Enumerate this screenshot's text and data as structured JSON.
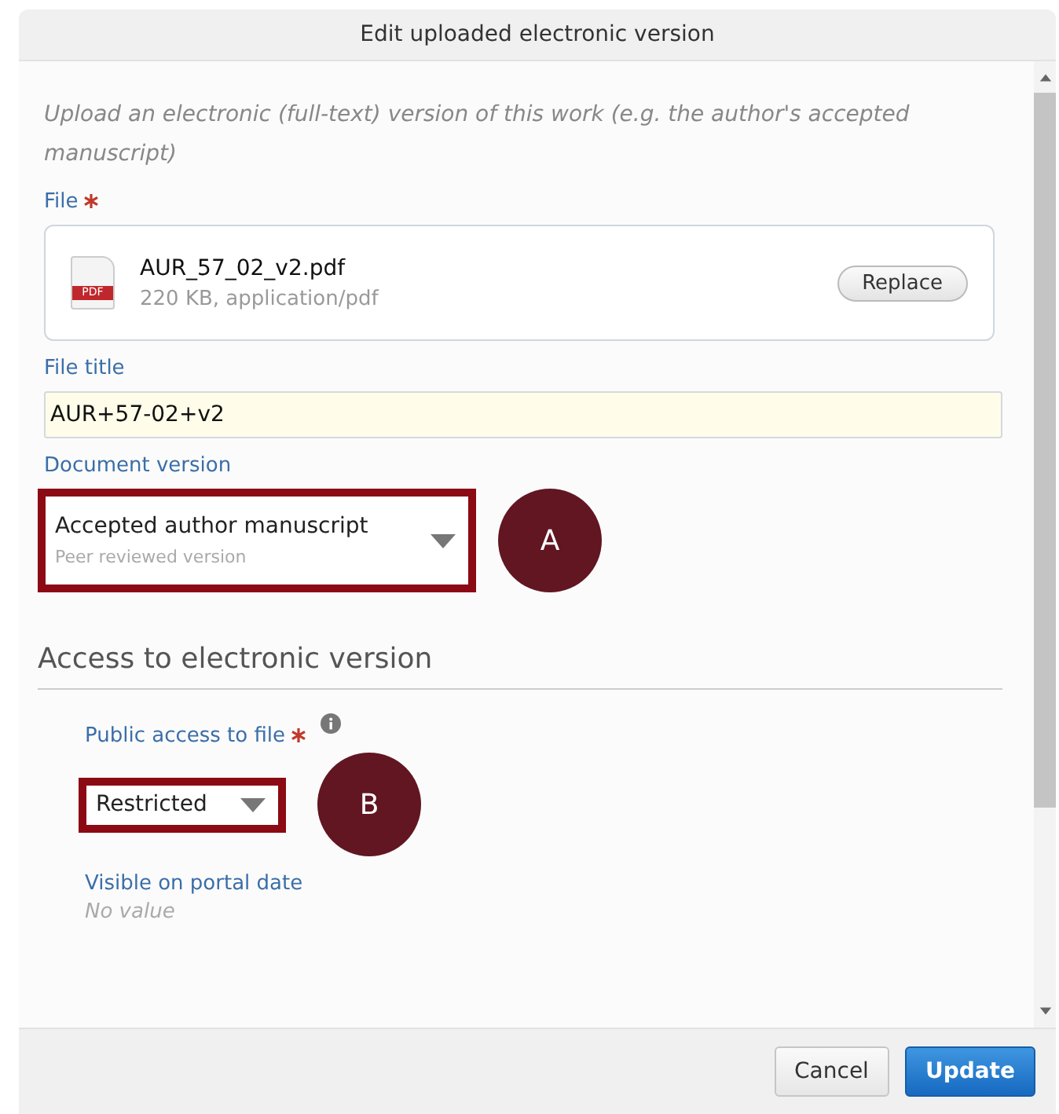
{
  "dialog": {
    "title": "Edit uploaded electronic version"
  },
  "intro": "Upload an electronic (full-text) version of this work (e.g. the author's accepted manuscript)",
  "file": {
    "label": "File",
    "required": true,
    "name": "AUR_57_02_v2.pdf",
    "meta": "220 KB, application/pdf",
    "icon_text": "PDF",
    "button": "Replace"
  },
  "file_title": {
    "label": "File title",
    "value": "AUR+57-02+v2"
  },
  "document_version": {
    "label": "Document version",
    "value": "Accepted author manuscript",
    "note": "Peer reviewed version",
    "highlighted": true,
    "callout": "A"
  },
  "section": {
    "heading": "Access to electronic version"
  },
  "public_access": {
    "label": "Public access to file",
    "required": true,
    "info": true,
    "value": "Restricted",
    "highlighted": true,
    "callout": "B"
  },
  "visible_date": {
    "label": "Visible on portal date",
    "value": "No value"
  },
  "buttons": [
    {
      "label": "Cancel",
      "kind": "secondary"
    },
    {
      "label": "Update",
      "kind": "primary"
    }
  ]
}
